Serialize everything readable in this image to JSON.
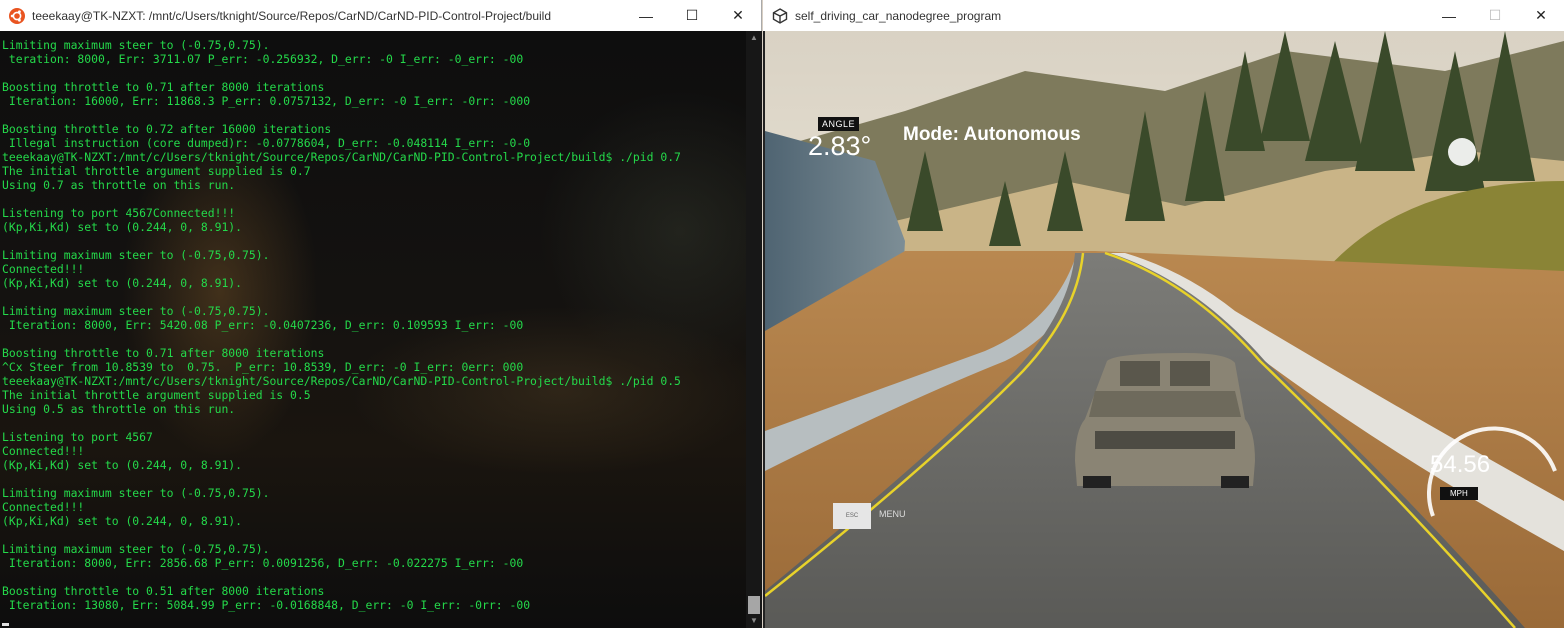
{
  "terminal": {
    "title": "teeekaay@TK-NZXT: /mnt/c/Users/tknight/Source/Repos/CarND/CarND-PID-Control-Project/build",
    "icon": "ubuntu-icon",
    "lines": [
      "Limiting maximum steer to (-0.75,0.75).",
      " teration: 8000, Err: 3711.07 P_err: -0.256932, D_err: -0 I_err: -0_err: -00",
      "",
      "Boosting throttle to 0.71 after 8000 iterations",
      " Iteration: 16000, Err: 11868.3 P_err: 0.0757132, D_err: -0 I_err: -0rr: -000",
      "",
      "Boosting throttle to 0.72 after 16000 iterations",
      " Illegal instruction (core dumped)r: -0.0778604, D_err: -0.048114 I_err: -0-0",
      "teeekaay@TK-NZXT:/mnt/c/Users/tknight/Source/Repos/CarND/CarND-PID-Control-Project/build$ ./pid 0.7",
      "The initial throttle argument supplied is 0.7",
      "Using 0.7 as throttle on this run.",
      "",
      "Listening to port 4567Connected!!!",
      "(Kp,Ki,Kd) set to (0.244, 0, 8.91).",
      "",
      "Limiting maximum steer to (-0.75,0.75).",
      "Connected!!!",
      "(Kp,Ki,Kd) set to (0.244, 0, 8.91).",
      "",
      "Limiting maximum steer to (-0.75,0.75).",
      " Iteration: 8000, Err: 5420.08 P_err: -0.0407236, D_err: 0.109593 I_err: -00",
      "",
      "Boosting throttle to 0.71 after 8000 iterations",
      "^Cx Steer from 10.8539 to  0.75.  P_err: 10.8539, D_err: -0 I_err: 0err: 000",
      "teeekaay@TK-NZXT:/mnt/c/Users/tknight/Source/Repos/CarND/CarND-PID-Control-Project/build$ ./pid 0.5",
      "The initial throttle argument supplied is 0.5",
      "Using 0.5 as throttle on this run.",
      "",
      "Listening to port 4567",
      "Connected!!!",
      "(Kp,Ki,Kd) set to (0.244, 0, 8.91).",
      "",
      "Limiting maximum steer to (-0.75,0.75).",
      "Connected!!!",
      "(Kp,Ki,Kd) set to (0.244, 0, 8.91).",
      "",
      "Limiting maximum steer to (-0.75,0.75).",
      " Iteration: 8000, Err: 2856.68 P_err: 0.0091256, D_err: -0.022275 I_err: -00",
      "",
      "Boosting throttle to 0.51 after 8000 iterations",
      " Iteration: 13080, Err: 5084.99 P_err: -0.0168848, D_err: -0 I_err: -0rr: -00"
    ],
    "text_color": "#24d94a"
  },
  "simulator": {
    "title": "self_driving_car_nanodegree_program",
    "icon": "unity-icon",
    "angle_label": "ANGLE",
    "angle_value": "2.83°",
    "mode": "Mode: Autonomous",
    "speed_value": "54.56",
    "speed_unit": "MPH",
    "esc_label": "ESC",
    "menu_label": "MENU"
  },
  "window_controls": {
    "minimize": "—",
    "maximize": "☐",
    "close": "✕"
  }
}
